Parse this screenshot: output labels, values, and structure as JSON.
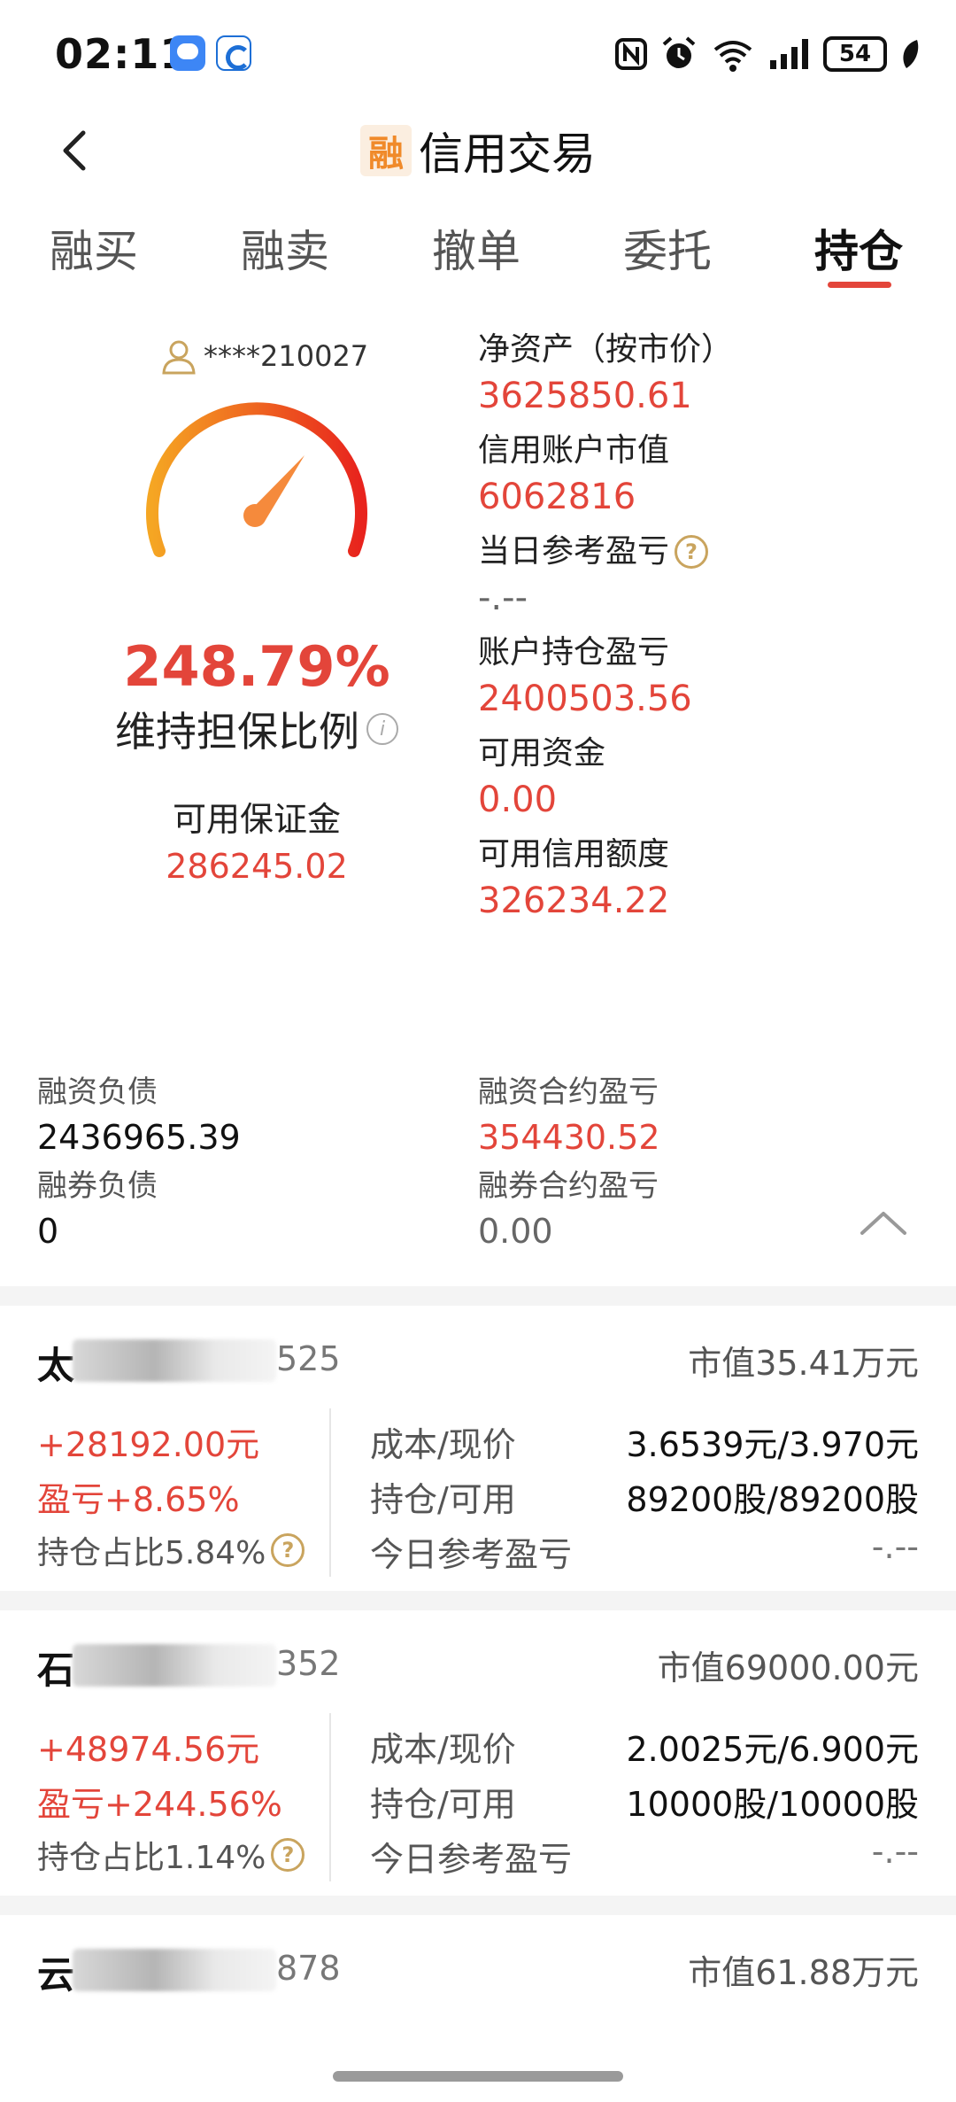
{
  "status_bar": {
    "time": "02:11",
    "battery": "54",
    "icons": [
      "chat-app-icon",
      "bank-app-icon",
      "nfc-icon",
      "alarm-icon",
      "wifi-6-icon",
      "signal-icon",
      "battery-icon",
      "leaf-icon"
    ]
  },
  "nav": {
    "title": "信用交易",
    "brand_char": "融"
  },
  "tabs": [
    "融买",
    "融卖",
    "撤单",
    "委托",
    "持仓"
  ],
  "active_tab": "持仓",
  "account": {
    "masked_id": "****210027"
  },
  "gauge": {
    "maintenance_ratio": "248.79%",
    "maintenance_label": "维持担保比例",
    "available_margin_label": "可用保证金",
    "available_margin": "286245.02"
  },
  "metrics": [
    {
      "label": "净资产（按市价）",
      "value": "3625850.61"
    },
    {
      "label": "信用账户市值",
      "value": "6062816"
    },
    {
      "label": "当日参考盈亏",
      "value": "-.--"
    },
    {
      "label": "账户持仓盈亏",
      "value": "2400503.56"
    },
    {
      "label": "可用资金",
      "value": "0.00"
    },
    {
      "label": "可用信用额度",
      "value": "326234.22"
    }
  ],
  "debts": {
    "margin_debt_label": "融资负债",
    "margin_debt": "2436965.39",
    "short_debt_label": "融券负债",
    "short_debt": "0",
    "margin_contract_pnl_label": "融资合约盈亏",
    "margin_contract_pnl": "354430.52",
    "short_contract_pnl_label": "融券合约盈亏",
    "short_contract_pnl": "0.00"
  },
  "positions": [
    {
      "name_visible": "太",
      "code_visible": "525",
      "market_value": "市值35.41万元",
      "pnl": "+28192.00元",
      "pnl_pct": "盈亏+8.65%",
      "share": "持仓占比5.84%",
      "cost_label": "成本/现价",
      "cost": "3.6539元/3.970元",
      "qty_label": "持仓/可用",
      "qty": "89200股/89200股",
      "today_label": "今日参考盈亏",
      "today": "-.--"
    },
    {
      "name_visible": "石",
      "code_visible": "352",
      "market_value": "市值69000.00元",
      "pnl": "+48974.56元",
      "pnl_pct": "盈亏+244.56%",
      "share": "持仓占比1.14%",
      "cost_label": "成本/现价",
      "cost": "2.0025元/6.900元",
      "qty_label": "持仓/可用",
      "qty": "10000股/10000股",
      "today_label": "今日参考盈亏",
      "today": "-.--"
    },
    {
      "name_visible": "云",
      "code_visible": "878",
      "market_value": "市值61.88万元"
    }
  ],
  "colors": {
    "accent_red": "#e3453a",
    "gauge_start": "#f5a623",
    "gauge_end": "#e8231d",
    "needle": "#f58a3c",
    "help_icon": "#c9a45e"
  }
}
